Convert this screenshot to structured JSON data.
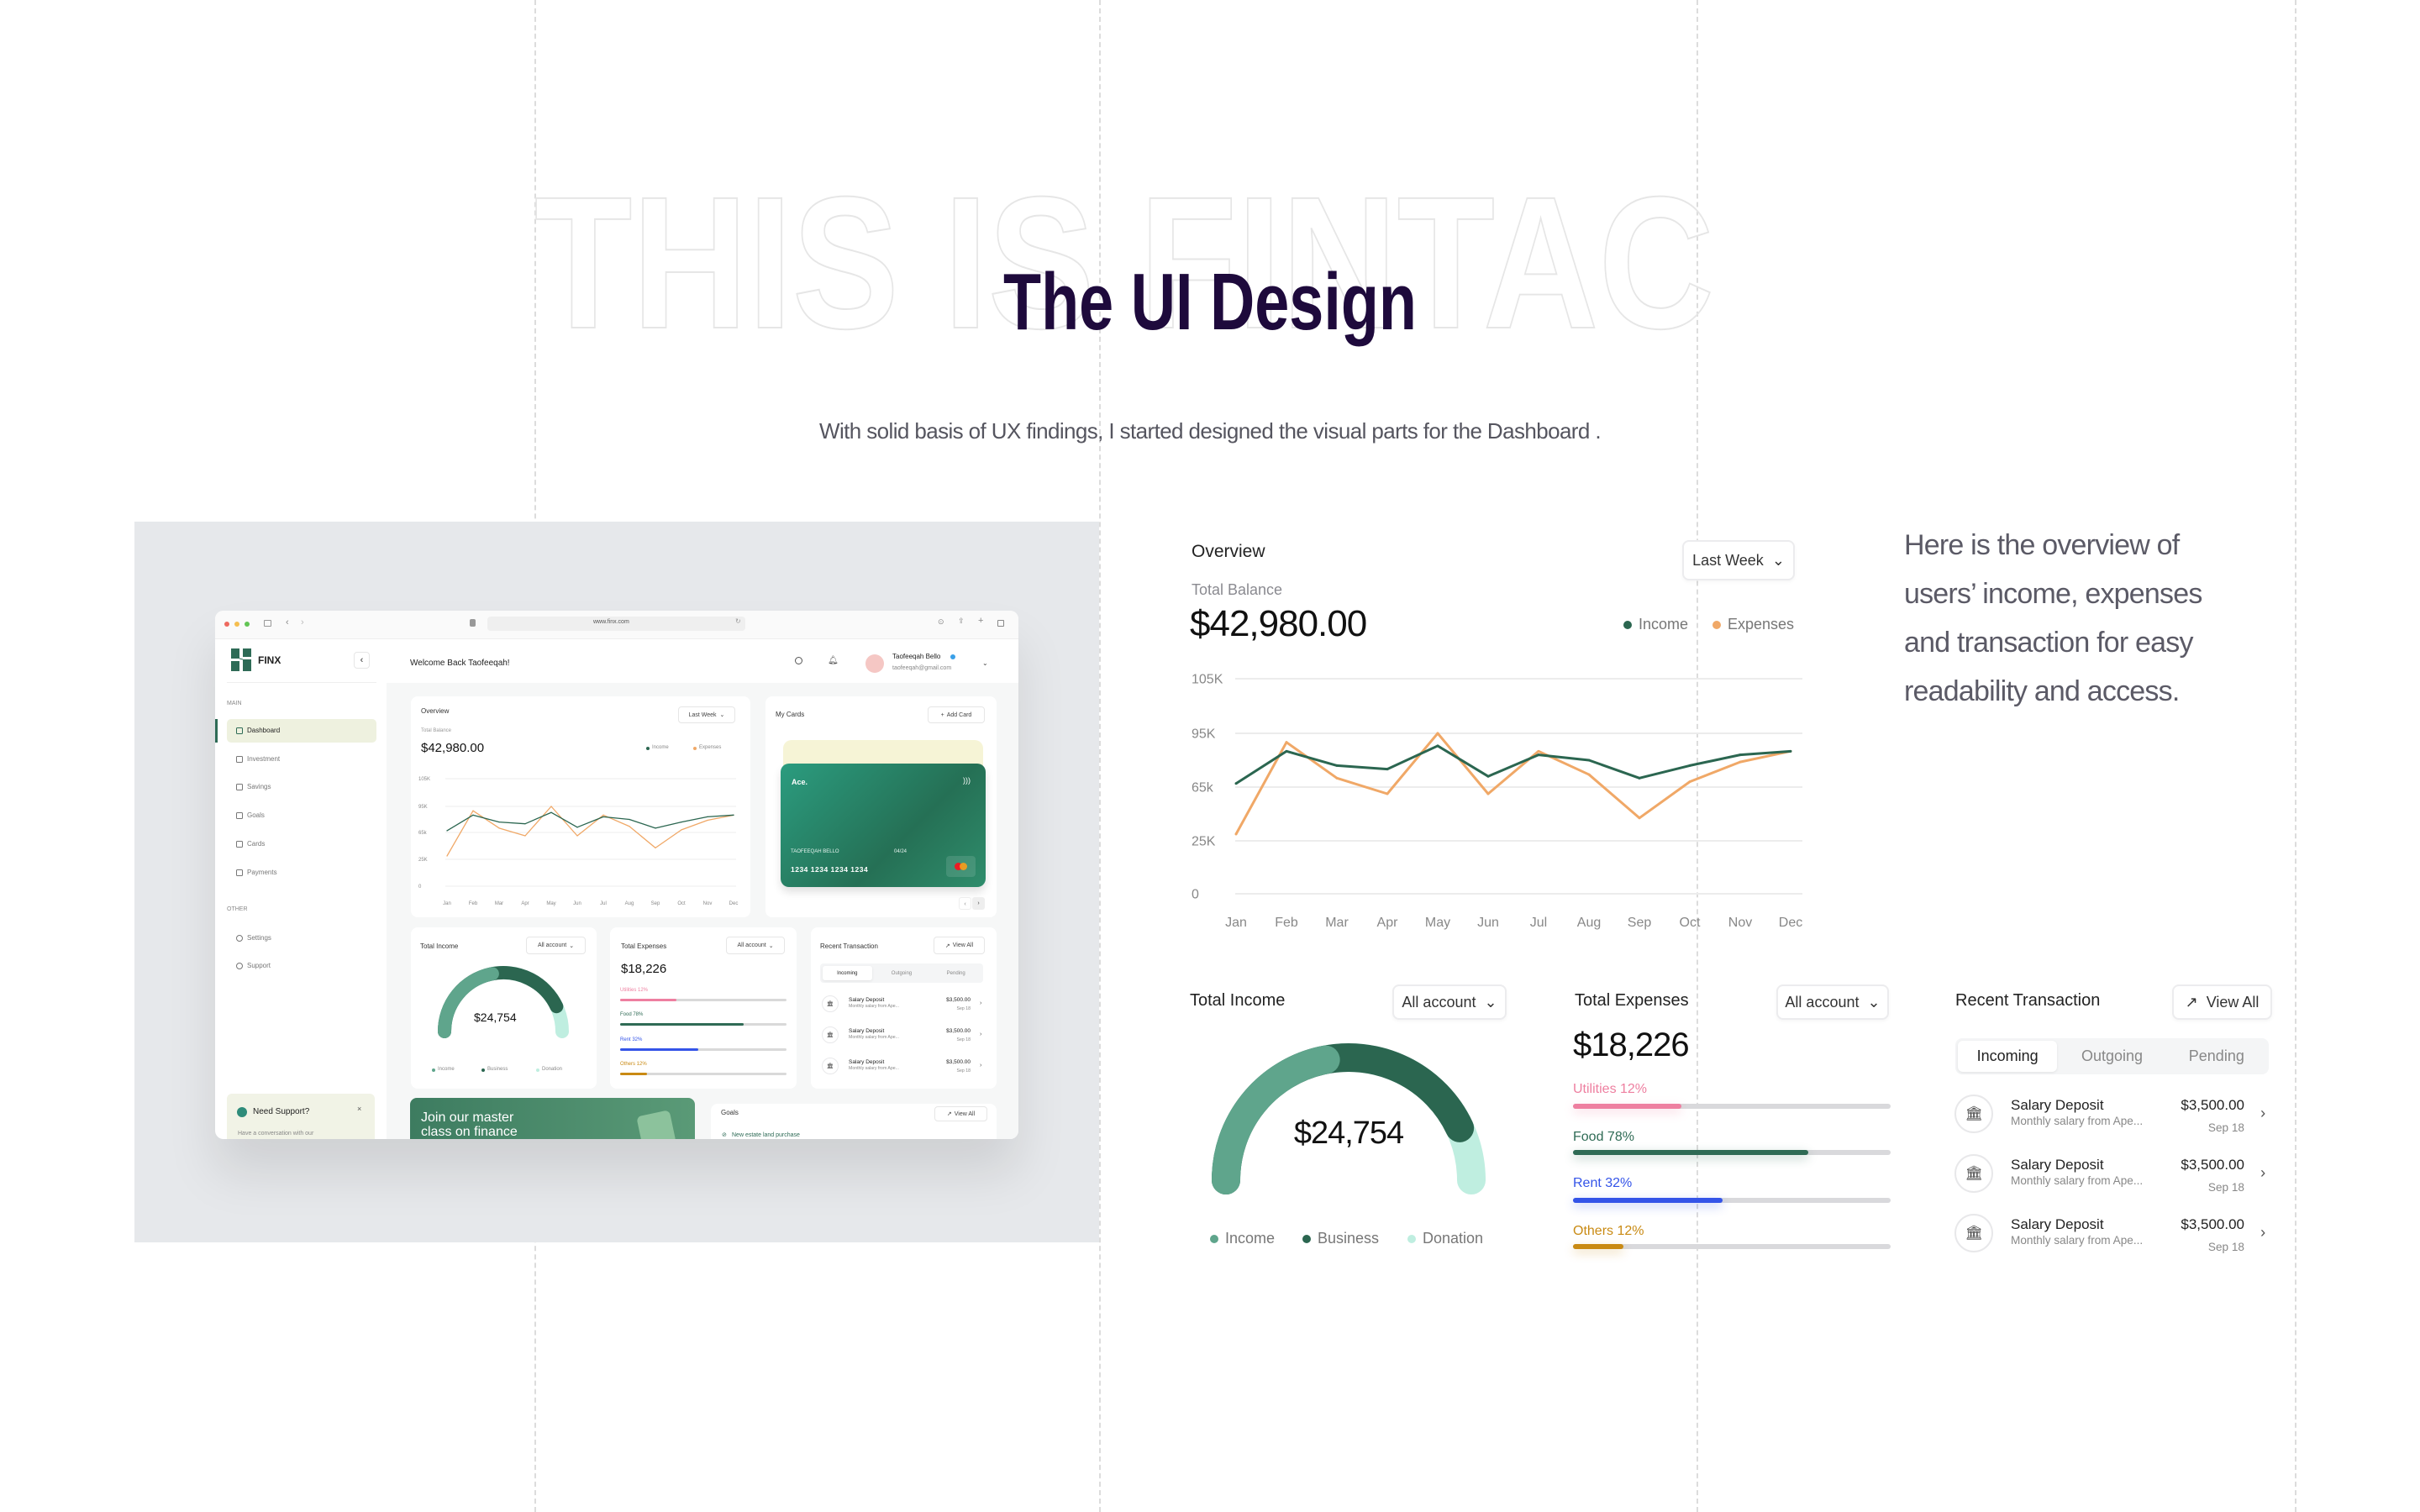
{
  "hero": {
    "outline_text": "THIS IS FINTAC",
    "title": "The UI Design",
    "subtitle": "With solid basis of UX findings, I started designed the visual parts for the Dashboard ."
  },
  "side_note": [
    "Here is the overview of",
    "users’ income, expenses",
    "and transaction for easy",
    "readability and access."
  ],
  "colors": {
    "brand_green": "#2e6b56",
    "income": "#2b6650",
    "expenses": "#f0a867",
    "title": "#1e0a3c",
    "panel": "#e6e8eb"
  },
  "browser": {
    "url": "www.finx.com"
  },
  "sidebar": {
    "brand": "FINX",
    "main_label": "MAIN",
    "main_items": [
      {
        "label": "Dashboard",
        "icon": "dashboard-icon",
        "active": true
      },
      {
        "label": "Investment",
        "icon": "investment-icon"
      },
      {
        "label": "Savings",
        "icon": "savings-icon"
      },
      {
        "label": "Goals",
        "icon": "goals-icon"
      },
      {
        "label": "Cards",
        "icon": "cards-icon"
      },
      {
        "label": "Payments",
        "icon": "payments-icon"
      }
    ],
    "other_label": "OTHER",
    "other_items": [
      {
        "label": "Settings",
        "icon": "gear-icon"
      },
      {
        "label": "Support",
        "icon": "headset-icon"
      }
    ],
    "support": {
      "title": "Need Support?",
      "text": "Have a conversation with our"
    }
  },
  "header": {
    "welcome": "Welcome Back Taofeeqah!",
    "user_name": "Taofeeqah Bello",
    "user_email": "taofeeqah@gmail.com"
  },
  "overview": {
    "title": "Overview",
    "period": "Last Week",
    "balance_label": "Total Balance",
    "balance": "$42,980.00",
    "legend": [
      "Income",
      "Expenses"
    ]
  },
  "chart_data": {
    "type": "line",
    "categories": [
      "Jan",
      "Feb",
      "Mar",
      "Apr",
      "May",
      "Jun",
      "Jul",
      "Aug",
      "Sep",
      "Oct",
      "Nov",
      "Dec"
    ],
    "y_ticks": [
      "105K",
      "95K",
      "65k",
      "25K",
      "0"
    ],
    "y_tick_values": [
      105000,
      95000,
      65000,
      25000,
      0
    ],
    "series": [
      {
        "name": "Income",
        "color": "#2b6650",
        "values": [
          67000,
          85000,
          77000,
          75000,
          88000,
          71000,
          83000,
          80000,
          70000,
          77000,
          83000,
          85000
        ]
      },
      {
        "name": "Expenses",
        "color": "#f0a867",
        "values": [
          30000,
          90000,
          70000,
          60000,
          95000,
          60000,
          85000,
          72000,
          42000,
          68000,
          79000,
          85000
        ]
      }
    ],
    "grid": true,
    "legend_position": "top-right"
  },
  "cards": {
    "title": "My Cards",
    "add_label": "Add Card",
    "card": {
      "brand": "Ace.",
      "holder": "TAOFEEQAH BELLO",
      "expiry": "04/24",
      "number": "1234 1234 1234 1234"
    }
  },
  "income": {
    "title": "Total Income",
    "filter": "All account",
    "value": "$24,754",
    "legend": [
      {
        "label": "Income",
        "color": "#5fa58c",
        "share": 0.44
      },
      {
        "label": "Business",
        "color": "#2b6650",
        "share": 0.42
      },
      {
        "label": "Donation",
        "color": "#bfeee0",
        "share": 0.14
      }
    ]
  },
  "expenses": {
    "title": "Total Expenses",
    "filter": "All account",
    "value": "$18,226",
    "items": [
      {
        "label": "Utilities 12%",
        "color": "#ee7fa0",
        "fill": 0.34
      },
      {
        "label": "Food 78%",
        "color": "#2f6b55",
        "fill": 0.74
      },
      {
        "label": "Rent 32%",
        "color": "#3454e8",
        "fill": 0.47
      },
      {
        "label": "Others 12%",
        "color": "#c98a13",
        "fill": 0.16
      }
    ]
  },
  "transactions": {
    "title": "Recent Transaction",
    "view_all": "View All",
    "tabs": [
      "Incoming",
      "Outgoing",
      "Pending"
    ],
    "active_tab": "Incoming",
    "rows": [
      {
        "name": "Salary Deposit",
        "desc": "Monthly salary from Ape...",
        "amount": "$3,500.00",
        "date": "Sep 18"
      },
      {
        "name": "Salary Deposit",
        "desc": "Monthly salary from Ape...",
        "amount": "$3,500.00",
        "date": "Sep 18"
      },
      {
        "name": "Salary Deposit",
        "desc": "Monthly salary from Ape...",
        "amount": "$3,500.00",
        "date": "Sep 18"
      }
    ]
  },
  "banner": {
    "text": "Join our master class on finance"
  },
  "goals": {
    "title": "Goals",
    "view_all": "View All",
    "item": "New estate land purchase"
  }
}
